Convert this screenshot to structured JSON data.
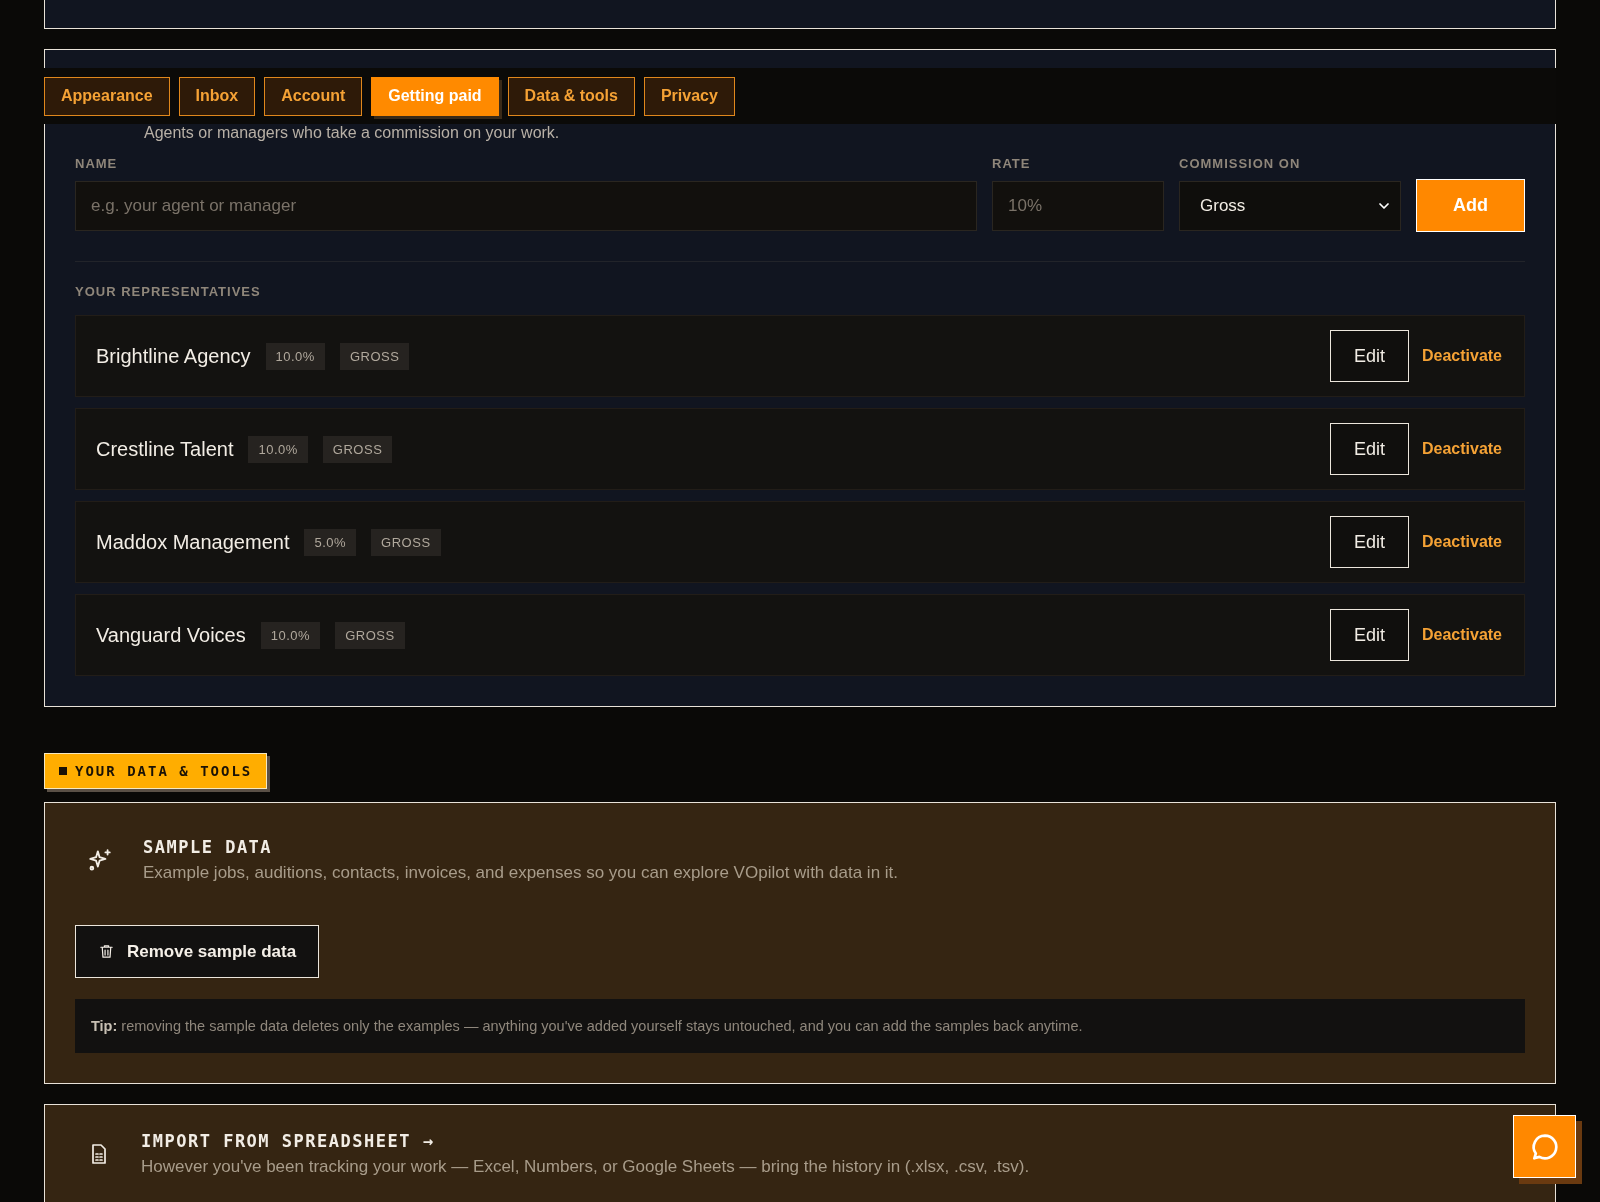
{
  "tabs": [
    {
      "label": "Appearance",
      "selected": false
    },
    {
      "label": "Inbox",
      "selected": false
    },
    {
      "label": "Account",
      "selected": false
    },
    {
      "label": "Getting paid",
      "selected": true
    },
    {
      "label": "Data & tools",
      "selected": false
    },
    {
      "label": "Privacy",
      "selected": false
    }
  ],
  "representatives_card": {
    "intro": "Agents or managers who take a commission on your work.",
    "form": {
      "name_label": "NAME",
      "name_placeholder": "e.g. your agent or manager",
      "rate_label": "RATE",
      "rate_placeholder": "10%",
      "commission_label": "COMMISSION ON",
      "commission_value": "Gross",
      "add_button": "Add"
    },
    "list_heading": "YOUR REPRESENTATIVES",
    "representatives": [
      {
        "name": "Brightline Agency",
        "rate": "10.0%",
        "basis": "GROSS",
        "edit": "Edit",
        "deactivate": "Deactivate"
      },
      {
        "name": "Crestline Talent",
        "rate": "10.0%",
        "basis": "GROSS",
        "edit": "Edit",
        "deactivate": "Deactivate"
      },
      {
        "name": "Maddox Management",
        "rate": "5.0%",
        "basis": "GROSS",
        "edit": "Edit",
        "deactivate": "Deactivate"
      },
      {
        "name": "Vanguard Voices",
        "rate": "10.0%",
        "basis": "GROSS",
        "edit": "Edit",
        "deactivate": "Deactivate"
      }
    ]
  },
  "data_tools": {
    "badge": "YOUR DATA & TOOLS",
    "sample_data": {
      "title": "SAMPLE DATA",
      "description": "Example jobs, auditions, contacts, invoices, and expenses so you can explore VOpilot with data in it.",
      "button": "Remove sample data",
      "tip": "**Tip:** removing the sample data deletes only the examples — anything you've added yourself stays untouched, and you can add the samples back anytime."
    },
    "import": {
      "title": "IMPORT FROM SPREADSHEET →",
      "description": "However you've been tracking your work — Excel, Numbers, or Google Sheets — bring the history in (.xlsx, .csv, .tsv)."
    }
  }
}
